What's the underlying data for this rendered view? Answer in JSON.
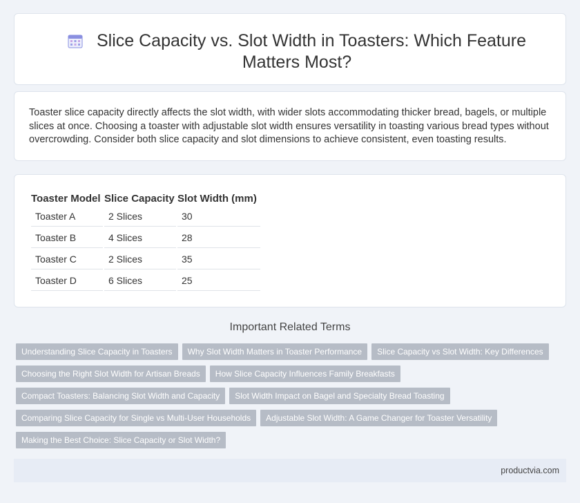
{
  "header": {
    "icon": "calendar-grid-icon",
    "title": "Slice Capacity vs. Slot Width in Toasters: Which Feature Matters Most?"
  },
  "intro": {
    "text": "Toaster slice capacity directly affects the slot width, with wider slots accommodating thicker bread, bagels, or multiple slices at once. Choosing a toaster with adjustable slot width ensures versatility in toasting various bread types without overcrowding. Consider both slice capacity and slot dimensions to achieve consistent, even toasting results."
  },
  "table": {
    "headers": [
      "Toaster Model",
      "Slice Capacity",
      "Slot Width (mm)"
    ],
    "rows": [
      [
        "Toaster A",
        "2 Slices",
        "30"
      ],
      [
        "Toaster B",
        "4 Slices",
        "28"
      ],
      [
        "Toaster C",
        "2 Slices",
        "35"
      ],
      [
        "Toaster D",
        "6 Slices",
        "25"
      ]
    ]
  },
  "related": {
    "heading": "Important Related Terms",
    "rows": [
      [
        "Understanding Slice Capacity in Toasters",
        "Why Slot Width Matters in Toaster Performance",
        "Slice Capacity vs Slot Width: Key Differences"
      ],
      [
        "Choosing the Right Slot Width for Artisan Breads",
        "How Slice Capacity Influences Family Breakfasts"
      ],
      [
        "Compact Toasters: Balancing Slot Width and Capacity",
        "Slot Width Impact on Bagel and Specialty Bread Toasting"
      ],
      [
        "Comparing Slice Capacity for Single vs Multi-User Households",
        "Adjustable Slot Width: A Game Changer for Toaster Versatility"
      ],
      [
        "Making the Best Choice: Slice Capacity or Slot Width?"
      ]
    ]
  },
  "footer": {
    "site": "productvia.com"
  },
  "colors": {
    "background": "#f0f3f8",
    "tag": "#b6bcc6",
    "footer": "#e7ecf5",
    "icon": "#8a8fe0"
  }
}
